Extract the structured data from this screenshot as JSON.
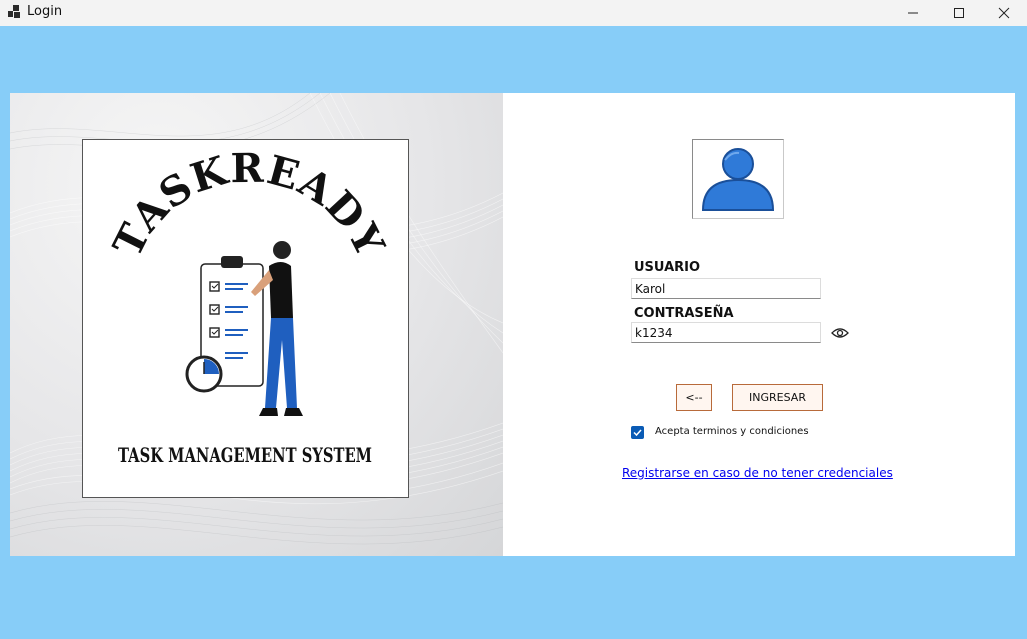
{
  "window": {
    "title": "Login",
    "icon": "app-window-icon"
  },
  "brand": {
    "logo_name": "TASKREADY",
    "logo_tagline": "TASK MANAGEMENT SYSTEM"
  },
  "form": {
    "user_label": "USUARIO",
    "user_value": "Karol",
    "password_label": "CONTRASEÑA",
    "password_value": "k1234",
    "back_button_label": "<--",
    "submit_button_label": "INGRESAR",
    "terms_checked": true,
    "terms_label": "Acepta terminos y condiciones",
    "register_link": "Registrarse en caso de no tener credenciales"
  },
  "colors": {
    "background": "#87cdf8",
    "accent": "#0a5bb5",
    "avatar": "#2f7ad8",
    "button_border": "#b86a3a"
  }
}
